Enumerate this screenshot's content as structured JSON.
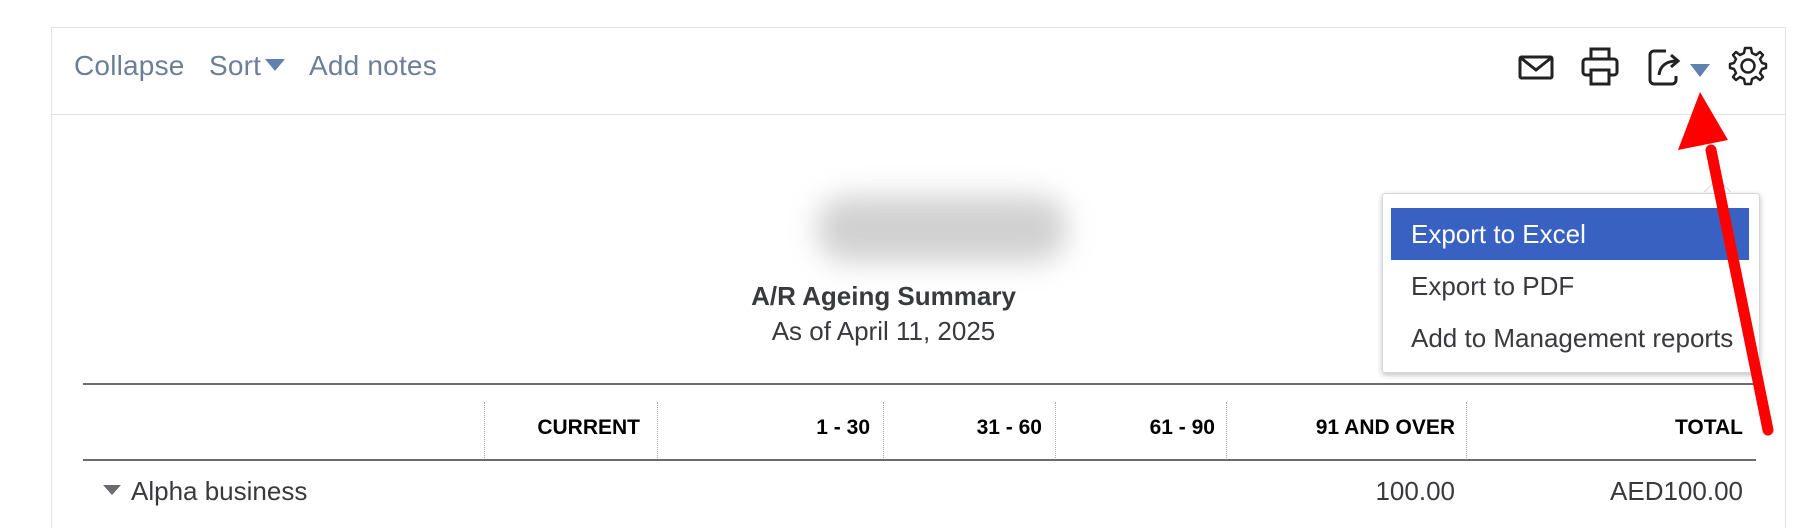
{
  "toolbar": {
    "collapse_label": "Collapse",
    "sort_label": "Sort",
    "add_notes_label": "Add notes",
    "icons": [
      "email-icon",
      "print-icon",
      "export-icon",
      "settings-gear-icon"
    ]
  },
  "report": {
    "company_name_hidden": "",
    "title": "A/R Ageing Summary",
    "date": "As of April 11, 2025"
  },
  "table": {
    "columns": [
      "CURRENT",
      "1 - 30",
      "31 - 60",
      "61 - 90",
      "91 AND OVER",
      "TOTAL"
    ],
    "rows": [
      {
        "label": "Alpha business",
        "current": "",
        "d1_30": "",
        "d31_60": "",
        "d61_90": "",
        "d91_over": "100.00",
        "total": "AED100.00"
      }
    ]
  },
  "export_menu": {
    "items": [
      "Export to Excel",
      "Export to PDF",
      "Add to Management reports"
    ],
    "highlighted_index": 0
  },
  "colors": {
    "link": "#6b7f99",
    "accent": "#5f82b0",
    "highlight": "#3861c2",
    "annotation_arrow": "#ff0000"
  }
}
